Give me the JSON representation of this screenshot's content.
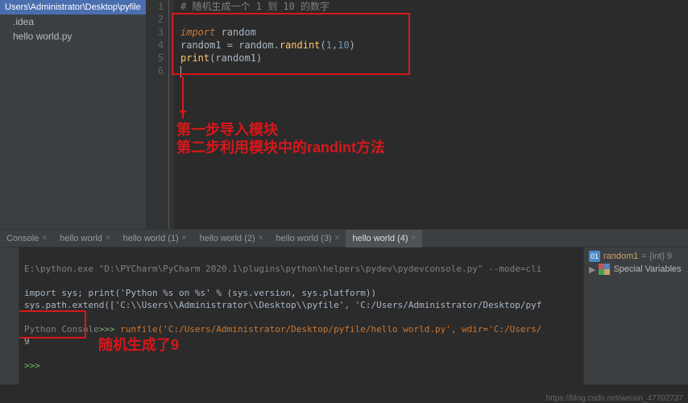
{
  "sidebar": {
    "title": "Users\\Administrator\\Desktop\\pyfile",
    "items": [
      ".idea",
      "hello world.py"
    ]
  },
  "gutter": [
    "1",
    "2",
    "3",
    "4",
    "5",
    "6"
  ],
  "code": {
    "l1_comment": "# 随机生成一个 1 到 10 的数字",
    "l3_kw": "import",
    "l3_mod": " random",
    "l4_a": "random1 = random.",
    "l4_fn": "randint",
    "l4_p1": "(",
    "l4_n1": "1",
    "l4_c": ",",
    "l4_n2": "10",
    "l4_p2": ")",
    "l5_fn": "print",
    "l5_p1": "(",
    "l5_arg": "random1",
    "l5_p2": ")"
  },
  "annotations": {
    "step1": "第一步导入模块",
    "step2": "第二步利用模块中的randint方法",
    "result": "随机生成了9"
  },
  "tabs": {
    "items": [
      "Console",
      "hello world",
      "hello world (1)",
      "hello world (2)",
      "hello world (3)",
      "hello world (4)"
    ],
    "active": 5
  },
  "console": {
    "line1": "E:\\python.exe \"D:\\PYCharm\\PyCharm 2020.1\\plugins\\python\\helpers\\pydev\\pydevconsole.py\" --mode=cli",
    "line2": "import sys; print('Python %s on %s' % (sys.version, sys.platform))",
    "line3": "sys.path.extend(['C:\\\\Users\\\\Administrator\\\\Desktop\\\\pyfile', 'C:/Users/Administrator/Desktop/pyf",
    "prompt_label": "Python Console",
    "prompt": ">>> ",
    "runcmd": "runfile('C:/Users/Administrator/Desktop/pyfile/hello world.py', wdir='C:/Users/",
    "output": "9",
    "prompt2": ">>> "
  },
  "vars": {
    "v1_name": "random1",
    "v1_type": " = {int} 9",
    "v2": "Special Variables"
  },
  "footer": "https://blog.csdn.net/weixin_47702737"
}
